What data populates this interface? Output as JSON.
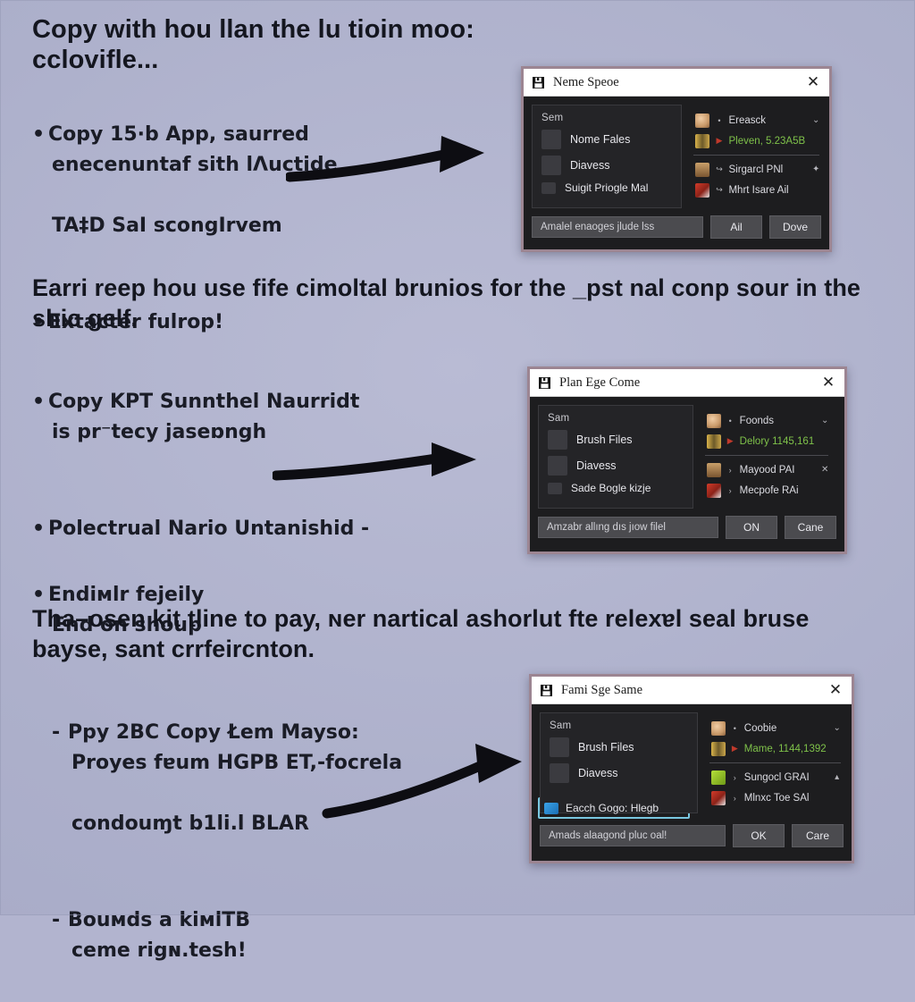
{
  "page": {
    "background_color": "#b2b4cf",
    "text_color": "#14161f"
  },
  "sections": [
    {
      "heading": "Copy with hou llan the lu tioin moo: cclovifle...",
      "bullets": [
        {
          "mark": "•",
          "lines": [
            "Copy 15·b App, saurred",
            "enecenuntaf sith lΛuctide",
            "TA‡D SaI scongIrvem"
          ]
        },
        {
          "mark": "•",
          "lines": [
            "Extacter fulrop!"
          ]
        }
      ]
    },
    {
      "heading": "Earri reep hou use fife cimoltal brunios for the _pst nal conp sour in the ѕhic gelf.",
      "bullets": [
        {
          "mark": "•",
          "lines": [
            "Copy KPT Sunnthel Naurridt",
            "is pr⁻tecy jaseɒngh"
          ]
        },
        {
          "mark": "•",
          "lines": [
            "Polectrual Nario Untanishid -"
          ]
        },
        {
          "mark": "•",
          "lines": [
            "Endiмlr fejeily",
            "End on shoup"
          ]
        }
      ]
    },
    {
      "heading": "Tha–osen kit tline to pay, ɴer nartical ashorlut fte relexɐl seal bruse bayse, sant crrfeircnton.",
      "bullets": [
        {
          "mark": "-",
          "lines": [
            "Ppy 2BC Copy Łem Mayso:",
            "Proyes fɐum HGPB ET,-focrela",
            "  condouɱt b1li.l BLAR"
          ]
        },
        {
          "mark": "-",
          "lines": [
            "Bouмds a kiмlTB",
            "ceme rigɴ.tesh!"
          ]
        }
      ]
    }
  ],
  "arrows": [
    {
      "name": "arrow-to-dialog-1"
    },
    {
      "name": "arrow-to-dialog-2"
    },
    {
      "name": "arrow-to-dialog-3"
    }
  ],
  "dialogs": [
    {
      "title": "Neme Speoe",
      "title_icon": "save-disk-icon",
      "close_label": "✕",
      "left": {
        "section_label": "Sem",
        "items": [
          {
            "label": "Nome Fales",
            "icon": "red-folder-icon",
            "icon_class": "ic-red",
            "size": "big"
          },
          {
            "label": "Diavess",
            "icon": "portrait-icon",
            "icon_class": "ic-tan",
            "size": "big"
          },
          {
            "label": "Suigit Priogle Mal",
            "icon": "blue-mail-icon",
            "icon_class": "ic-blue",
            "size": "small"
          }
        ]
      },
      "right": {
        "rows": [
          {
            "label": "Ereasck",
            "icon": "head-avatar-icon",
            "icon_class": "ic-head",
            "caret": "•",
            "end": "⌄",
            "green": false
          },
          {
            "label": "Pleven, 5.23A5Β",
            "icon": "film-strip-icon",
            "icon_class": "ic-film",
            "caret": "▶",
            "end": "",
            "green": true
          },
          {
            "label": "Sirgarcl PNl",
            "icon": "door-icon",
            "icon_class": "ic-door",
            "caret": "↪",
            "end": "✦",
            "green": false
          },
          {
            "label": "Mhrt Isare Ail",
            "icon": "book-icon",
            "icon_class": "ic-book",
            "caret": "↪",
            "end": "",
            "green": false
          }
        ],
        "separator_after_index": 1
      },
      "footer": {
        "wide_button": "Amalel enaoges jlude lss",
        "buttons": [
          "Ail",
          "Dove"
        ]
      },
      "highlighted_item": null
    },
    {
      "title": "Plan Ege Come",
      "title_icon": "save-disk-icon",
      "close_label": "✕",
      "left": {
        "section_label": "Sam",
        "items": [
          {
            "label": "Brush Files",
            "icon": "red-folder-icon",
            "icon_class": "ic-red",
            "size": "big"
          },
          {
            "label": "Diavess",
            "icon": "portrait-icon",
            "icon_class": "ic-tan",
            "size": "big"
          },
          {
            "label": "Sade Bogle kizje",
            "icon": "blue-mail-icon",
            "icon_class": "ic-blue",
            "size": "small"
          }
        ]
      },
      "right": {
        "rows": [
          {
            "label": "Foonds",
            "icon": "head-avatar-icon",
            "icon_class": "ic-head",
            "caret": "•",
            "end": "⌄",
            "green": false
          },
          {
            "label": "Delory 1145,161",
            "icon": "film-strip-icon",
            "icon_class": "ic-film",
            "caret": "▶",
            "end": "",
            "green": true
          },
          {
            "label": "Mayood PAI",
            "icon": "door-icon",
            "icon_class": "ic-door",
            "caret": "›",
            "end": "✕",
            "green": false
          },
          {
            "label": "Mecpofe RAi",
            "icon": "book-icon",
            "icon_class": "ic-book",
            "caret": "›",
            "end": "",
            "green": false
          }
        ],
        "separator_after_index": 1
      },
      "footer": {
        "wide_button": "Amzabr allıng dıs jıow filel",
        "buttons": [
          "ON",
          "Cane"
        ]
      },
      "highlighted_item": null
    },
    {
      "title": "Fami Sge Same",
      "title_icon": "save-disk-icon",
      "close_label": "✕",
      "left": {
        "section_label": "Sam",
        "items": [
          {
            "label": "Brush Files",
            "icon": "red-folder-icon",
            "icon_class": "ic-red",
            "size": "big"
          },
          {
            "label": "Diavess",
            "icon": "portrait-icon",
            "icon_class": "ic-tan",
            "size": "big"
          }
        ]
      },
      "right": {
        "rows": [
          {
            "label": "Coobie",
            "icon": "head-avatar-icon",
            "icon_class": "ic-head",
            "caret": "•",
            "end": "⌄",
            "green": false
          },
          {
            "label": "Mame, 1144,1392",
            "icon": "film-strip-icon",
            "icon_class": "ic-film",
            "caret": "▶",
            "end": "",
            "green": true
          },
          {
            "label": "Sungocl GRAI",
            "icon": "green-app-icon",
            "icon_class": "ic-green",
            "caret": "›",
            "end": "▴",
            "green": false
          },
          {
            "label": "Mlnxc Toe SAl",
            "icon": "book-icon",
            "icon_class": "ic-book",
            "caret": "›",
            "end": "",
            "green": false
          }
        ],
        "separator_after_index": 1
      },
      "footer": {
        "wide_button": "Amads alaagond pluc ᴏal!",
        "buttons": [
          "OK",
          "Care"
        ]
      },
      "highlighted_item": {
        "label": "Eacch Gogo: Hlegb",
        "icon": "blue-mail-icon",
        "icon_class": "ic-blue",
        "border_color": "#79c7e0"
      }
    }
  ]
}
